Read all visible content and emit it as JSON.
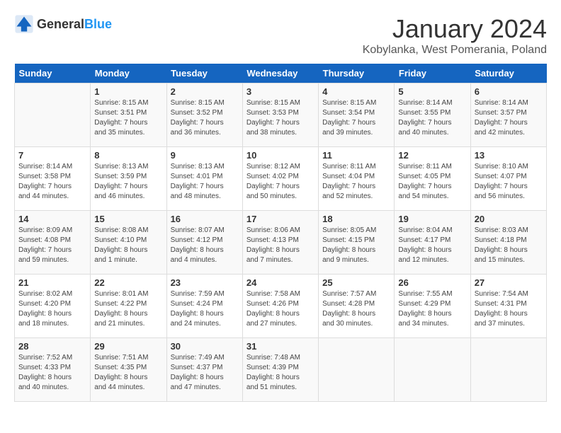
{
  "header": {
    "logo_general": "General",
    "logo_blue": "Blue",
    "month_title": "January 2024",
    "location": "Kobylanka, West Pomerania, Poland"
  },
  "days_of_week": [
    "Sunday",
    "Monday",
    "Tuesday",
    "Wednesday",
    "Thursday",
    "Friday",
    "Saturday"
  ],
  "weeks": [
    [
      {
        "day": "",
        "info": ""
      },
      {
        "day": "1",
        "info": "Sunrise: 8:15 AM\nSunset: 3:51 PM\nDaylight: 7 hours\nand 35 minutes."
      },
      {
        "day": "2",
        "info": "Sunrise: 8:15 AM\nSunset: 3:52 PM\nDaylight: 7 hours\nand 36 minutes."
      },
      {
        "day": "3",
        "info": "Sunrise: 8:15 AM\nSunset: 3:53 PM\nDaylight: 7 hours\nand 38 minutes."
      },
      {
        "day": "4",
        "info": "Sunrise: 8:15 AM\nSunset: 3:54 PM\nDaylight: 7 hours\nand 39 minutes."
      },
      {
        "day": "5",
        "info": "Sunrise: 8:14 AM\nSunset: 3:55 PM\nDaylight: 7 hours\nand 40 minutes."
      },
      {
        "day": "6",
        "info": "Sunrise: 8:14 AM\nSunset: 3:57 PM\nDaylight: 7 hours\nand 42 minutes."
      }
    ],
    [
      {
        "day": "7",
        "info": "Sunrise: 8:14 AM\nSunset: 3:58 PM\nDaylight: 7 hours\nand 44 minutes."
      },
      {
        "day": "8",
        "info": "Sunrise: 8:13 AM\nSunset: 3:59 PM\nDaylight: 7 hours\nand 46 minutes."
      },
      {
        "day": "9",
        "info": "Sunrise: 8:13 AM\nSunset: 4:01 PM\nDaylight: 7 hours\nand 48 minutes."
      },
      {
        "day": "10",
        "info": "Sunrise: 8:12 AM\nSunset: 4:02 PM\nDaylight: 7 hours\nand 50 minutes."
      },
      {
        "day": "11",
        "info": "Sunrise: 8:11 AM\nSunset: 4:04 PM\nDaylight: 7 hours\nand 52 minutes."
      },
      {
        "day": "12",
        "info": "Sunrise: 8:11 AM\nSunset: 4:05 PM\nDaylight: 7 hours\nand 54 minutes."
      },
      {
        "day": "13",
        "info": "Sunrise: 8:10 AM\nSunset: 4:07 PM\nDaylight: 7 hours\nand 56 minutes."
      }
    ],
    [
      {
        "day": "14",
        "info": "Sunrise: 8:09 AM\nSunset: 4:08 PM\nDaylight: 7 hours\nand 59 minutes."
      },
      {
        "day": "15",
        "info": "Sunrise: 8:08 AM\nSunset: 4:10 PM\nDaylight: 8 hours\nand 1 minute."
      },
      {
        "day": "16",
        "info": "Sunrise: 8:07 AM\nSunset: 4:12 PM\nDaylight: 8 hours\nand 4 minutes."
      },
      {
        "day": "17",
        "info": "Sunrise: 8:06 AM\nSunset: 4:13 PM\nDaylight: 8 hours\nand 7 minutes."
      },
      {
        "day": "18",
        "info": "Sunrise: 8:05 AM\nSunset: 4:15 PM\nDaylight: 8 hours\nand 9 minutes."
      },
      {
        "day": "19",
        "info": "Sunrise: 8:04 AM\nSunset: 4:17 PM\nDaylight: 8 hours\nand 12 minutes."
      },
      {
        "day": "20",
        "info": "Sunrise: 8:03 AM\nSunset: 4:18 PM\nDaylight: 8 hours\nand 15 minutes."
      }
    ],
    [
      {
        "day": "21",
        "info": "Sunrise: 8:02 AM\nSunset: 4:20 PM\nDaylight: 8 hours\nand 18 minutes."
      },
      {
        "day": "22",
        "info": "Sunrise: 8:01 AM\nSunset: 4:22 PM\nDaylight: 8 hours\nand 21 minutes."
      },
      {
        "day": "23",
        "info": "Sunrise: 7:59 AM\nSunset: 4:24 PM\nDaylight: 8 hours\nand 24 minutes."
      },
      {
        "day": "24",
        "info": "Sunrise: 7:58 AM\nSunset: 4:26 PM\nDaylight: 8 hours\nand 27 minutes."
      },
      {
        "day": "25",
        "info": "Sunrise: 7:57 AM\nSunset: 4:28 PM\nDaylight: 8 hours\nand 30 minutes."
      },
      {
        "day": "26",
        "info": "Sunrise: 7:55 AM\nSunset: 4:29 PM\nDaylight: 8 hours\nand 34 minutes."
      },
      {
        "day": "27",
        "info": "Sunrise: 7:54 AM\nSunset: 4:31 PM\nDaylight: 8 hours\nand 37 minutes."
      }
    ],
    [
      {
        "day": "28",
        "info": "Sunrise: 7:52 AM\nSunset: 4:33 PM\nDaylight: 8 hours\nand 40 minutes."
      },
      {
        "day": "29",
        "info": "Sunrise: 7:51 AM\nSunset: 4:35 PM\nDaylight: 8 hours\nand 44 minutes."
      },
      {
        "day": "30",
        "info": "Sunrise: 7:49 AM\nSunset: 4:37 PM\nDaylight: 8 hours\nand 47 minutes."
      },
      {
        "day": "31",
        "info": "Sunrise: 7:48 AM\nSunset: 4:39 PM\nDaylight: 8 hours\nand 51 minutes."
      },
      {
        "day": "",
        "info": ""
      },
      {
        "day": "",
        "info": ""
      },
      {
        "day": "",
        "info": ""
      }
    ]
  ]
}
